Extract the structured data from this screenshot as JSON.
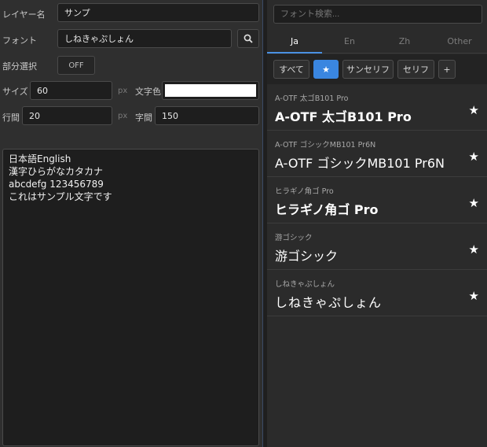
{
  "layer": {
    "label": "レイヤー名",
    "value": "サンプ"
  },
  "font": {
    "label": "フォント",
    "value": "しねきゃぷしょん"
  },
  "partial": {
    "label": "部分選択",
    "toggle": "OFF"
  },
  "size": {
    "label": "サイズ",
    "value": "60",
    "unit": "px"
  },
  "text_color": {
    "label": "文字色",
    "color": "#ffffff"
  },
  "line_spacing": {
    "label": "行間",
    "value": "20",
    "unit": "px"
  },
  "letter_spacing": {
    "label": "字間",
    "value": "150"
  },
  "text_lines": [
    "日本語English",
    "漢字ひらがなカタカナ",
    "abcdefg 123456789",
    "これはサンプル文字です"
  ],
  "picker": {
    "search_placeholder": "フォント検索...",
    "tabs": [
      "Ja",
      "En",
      "Zh",
      "Other"
    ],
    "filters": {
      "all": "すべて",
      "sans": "サンセリフ",
      "serif": "セリフ",
      "add": "+"
    },
    "fonts": [
      {
        "sub": "A-OTF 太ゴB101 Pro",
        "name": "A-OTF 太ゴB101 Pro"
      },
      {
        "sub": "A-OTF ゴシックMB101 Pr6N",
        "name": "A-OTF ゴシックMB101 Pr6N"
      },
      {
        "sub": "ヒラギノ角ゴ Pro",
        "name": "ヒラギノ角ゴ Pro"
      },
      {
        "sub": "游ゴシック",
        "name": "游ゴシック"
      },
      {
        "sub": "しねきゃぷしょん",
        "name": "しねきゃぷしょん"
      }
    ]
  }
}
